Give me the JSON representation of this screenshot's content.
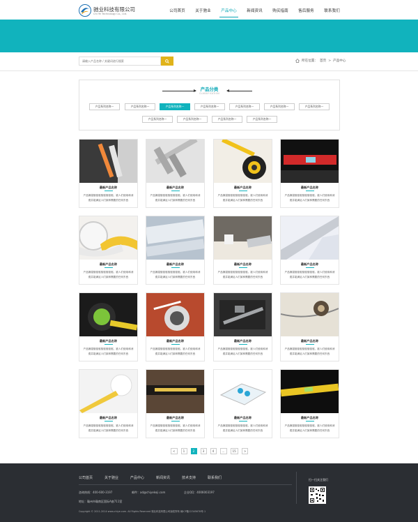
{
  "header": {
    "logo_cn": "驰业科技有限公司",
    "logo_en": "Chi Ye Technology Co., Ltd.",
    "nav": [
      {
        "label": "公司首页",
        "active": false
      },
      {
        "label": "关于驰业",
        "active": false
      },
      {
        "label": "产品中心",
        "active": true
      },
      {
        "label": "新闻资讯",
        "active": false
      },
      {
        "label": "购买指南",
        "active": false
      },
      {
        "label": "售后服务",
        "active": false
      },
      {
        "label": "联系我们",
        "active": false
      }
    ]
  },
  "search": {
    "placeholder": "请输入产品名称 / 关键词进行搜索"
  },
  "breadcrumb": {
    "prefix": "所在位置：",
    "home": "首页",
    "sep": ">",
    "current": "产品中心"
  },
  "category": {
    "title": "产品分类",
    "subtitle": "CLASSIFICATION",
    "items": [
      {
        "label": "产品系列名称一",
        "active": false
      },
      {
        "label": "产品系列名称一",
        "active": false
      },
      {
        "label": "产品系列名称一",
        "active": true
      },
      {
        "label": "产品系列名称一",
        "active": false
      },
      {
        "label": "产品系列名称一",
        "active": false
      },
      {
        "label": "产品系列名称一",
        "active": false
      },
      {
        "label": "产品系列名称一",
        "active": false
      },
      {
        "label": "产品系列名称一",
        "active": false
      },
      {
        "label": "产品系列名称一",
        "active": false
      },
      {
        "label": "产品系列名称一",
        "active": false
      },
      {
        "label": "产品系列名称一",
        "active": false
      }
    ]
  },
  "products": {
    "title": "最新产品名称",
    "desc": "产品摘描驱驱驱驱驱驱驱驱，被人们使用和消费并能满足人们某种需要的任何东西",
    "images": [
      "tape-on-cutter",
      "vernier-caliper",
      "yellow-tape-measure",
      "red-spirit-level",
      "soft-tape-measure",
      "steel-ruler-closeup",
      "desk-coffee",
      "steel-ruler-paper",
      "green-tape-measure",
      "round-tape-measure",
      "digital-caliper-case",
      "old-tape-measure",
      "white-tape-measure",
      "dark-ruler",
      "digital-scale",
      "yellow-spirit-level"
    ]
  },
  "pagination": [
    "<",
    "1",
    "2",
    "3",
    "4",
    "...",
    "15",
    ">"
  ],
  "pagination_active": "2",
  "footer": {
    "nav": [
      "公司首页",
      "关于驰业",
      "产品中心",
      "新闻资讯",
      "技术支持",
      "联系我们"
    ],
    "phone_label": "咨询热线：",
    "phone": "400-600-3197",
    "email_label": "邮件：",
    "email": "ad@chiyekeji.com",
    "qq_label": "企业QQ：",
    "qq": "4006003197",
    "address_label": "地址：",
    "address": "赣州市赣南区国际A座711室",
    "copyright": "Copyright © 2011-2014 www.chiye.com. All Rights Reserved  驰业科技有限公司版权所有 赣ICP备12345678号-1",
    "qr_label": "扫一扫关注我们"
  }
}
